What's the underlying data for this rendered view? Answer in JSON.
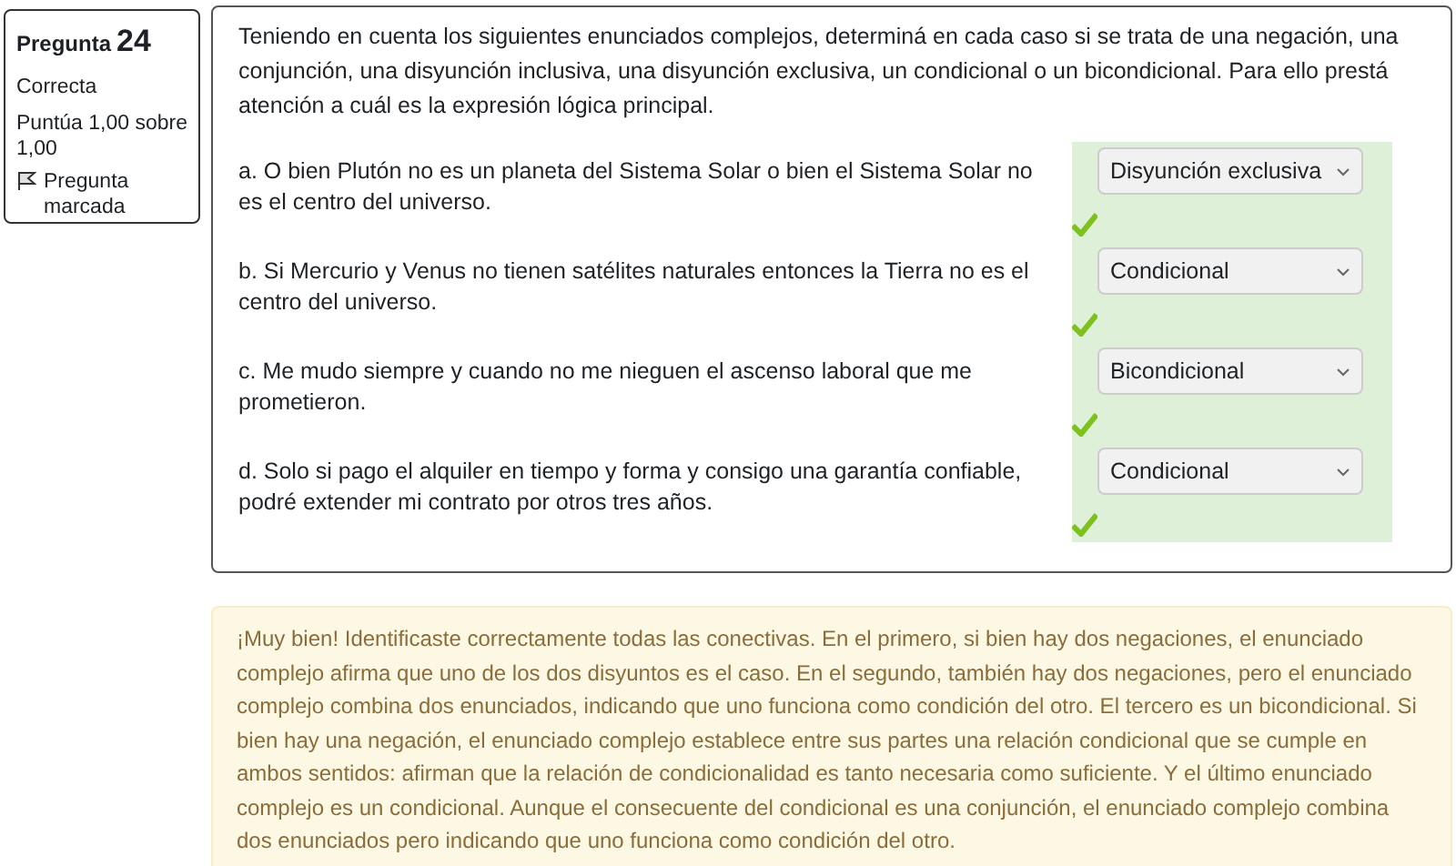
{
  "info": {
    "label": "Pregunta",
    "number": "24",
    "status": "Correcta",
    "score": "Puntúa 1,00 sobre 1,00",
    "flag": "Pregunta marcada",
    "flagged": true
  },
  "question": {
    "prompt": "Teniendo en cuenta los siguientes enunciados complejos, determiná en cada caso si se trata de una negación, una conjunción, una disyunción inclusiva, una disyunción exclusiva, un condicional o un bicondicional. Para ello prestá atención a cuál es la expresión lógica principal.",
    "items": [
      {
        "text": "a. O bien Plutón no es un planeta del Sistema Solar o bien el Sistema Solar no es el centro del universo.",
        "answer": "Disyunción exclusiva",
        "correct": true
      },
      {
        "text": "b. Si Mercurio y Venus no tienen satélites naturales entonces la Tierra no es el centro del universo.",
        "answer": "Condicional",
        "correct": true
      },
      {
        "text": "c. Me mudo siempre y cuando no me nieguen el ascenso laboral que me prometieron.",
        "answer": "Bicondicional",
        "correct": true
      },
      {
        "text": "d. Solo si pago el alquiler en tiempo y forma y consigo una garantía confiable, podré extender mi contrato por otros tres años.",
        "answer": "Condicional",
        "correct": true
      }
    ]
  },
  "feedback": "¡Muy bien! Identificaste correctamente todas las conectivas. En el primero, si bien hay dos negaciones, el enunciado complejo afirma que uno de los dos disyuntos es el caso. En el segundo, también hay dos negaciones, pero el enunciado complejo combina dos enunciados, indicando que uno funciona como condición del otro. El tercero es un bicondicional. Si bien hay una negación, el enunciado complejo establece entre sus partes una relación condicional que se cumple en ambos sentidos: afirman que la relación de condicionalidad es tanto necesaria como suficiente.  Y el último enunciado complejo  es un condicional. Aunque el consecuente del condicional es una conjunción, el enunciado complejo combina dos enunciados pero indicando que uno funciona como condición del otro."
}
